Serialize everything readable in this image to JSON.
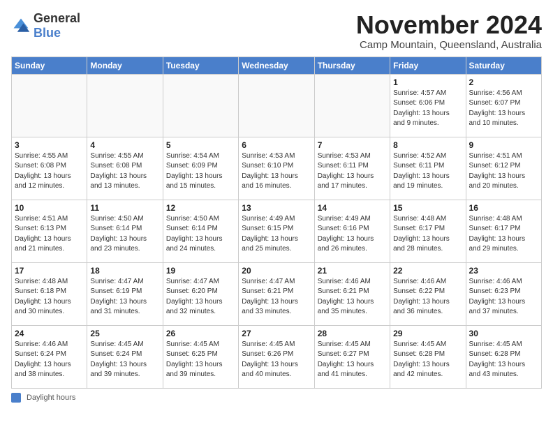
{
  "logo": {
    "general": "General",
    "blue": "Blue"
  },
  "header": {
    "month": "November 2024",
    "location": "Camp Mountain, Queensland, Australia"
  },
  "days_of_week": [
    "Sunday",
    "Monday",
    "Tuesday",
    "Wednesday",
    "Thursday",
    "Friday",
    "Saturday"
  ],
  "weeks": [
    [
      {
        "day": "",
        "info": ""
      },
      {
        "day": "",
        "info": ""
      },
      {
        "day": "",
        "info": ""
      },
      {
        "day": "",
        "info": ""
      },
      {
        "day": "",
        "info": ""
      },
      {
        "day": "1",
        "info": "Sunrise: 4:57 AM\nSunset: 6:06 PM\nDaylight: 13 hours and 9 minutes."
      },
      {
        "day": "2",
        "info": "Sunrise: 4:56 AM\nSunset: 6:07 PM\nDaylight: 13 hours and 10 minutes."
      }
    ],
    [
      {
        "day": "3",
        "info": "Sunrise: 4:55 AM\nSunset: 6:08 PM\nDaylight: 13 hours and 12 minutes."
      },
      {
        "day": "4",
        "info": "Sunrise: 4:55 AM\nSunset: 6:08 PM\nDaylight: 13 hours and 13 minutes."
      },
      {
        "day": "5",
        "info": "Sunrise: 4:54 AM\nSunset: 6:09 PM\nDaylight: 13 hours and 15 minutes."
      },
      {
        "day": "6",
        "info": "Sunrise: 4:53 AM\nSunset: 6:10 PM\nDaylight: 13 hours and 16 minutes."
      },
      {
        "day": "7",
        "info": "Sunrise: 4:53 AM\nSunset: 6:11 PM\nDaylight: 13 hours and 17 minutes."
      },
      {
        "day": "8",
        "info": "Sunrise: 4:52 AM\nSunset: 6:11 PM\nDaylight: 13 hours and 19 minutes."
      },
      {
        "day": "9",
        "info": "Sunrise: 4:51 AM\nSunset: 6:12 PM\nDaylight: 13 hours and 20 minutes."
      }
    ],
    [
      {
        "day": "10",
        "info": "Sunrise: 4:51 AM\nSunset: 6:13 PM\nDaylight: 13 hours and 21 minutes."
      },
      {
        "day": "11",
        "info": "Sunrise: 4:50 AM\nSunset: 6:14 PM\nDaylight: 13 hours and 23 minutes."
      },
      {
        "day": "12",
        "info": "Sunrise: 4:50 AM\nSunset: 6:14 PM\nDaylight: 13 hours and 24 minutes."
      },
      {
        "day": "13",
        "info": "Sunrise: 4:49 AM\nSunset: 6:15 PM\nDaylight: 13 hours and 25 minutes."
      },
      {
        "day": "14",
        "info": "Sunrise: 4:49 AM\nSunset: 6:16 PM\nDaylight: 13 hours and 26 minutes."
      },
      {
        "day": "15",
        "info": "Sunrise: 4:48 AM\nSunset: 6:17 PM\nDaylight: 13 hours and 28 minutes."
      },
      {
        "day": "16",
        "info": "Sunrise: 4:48 AM\nSunset: 6:17 PM\nDaylight: 13 hours and 29 minutes."
      }
    ],
    [
      {
        "day": "17",
        "info": "Sunrise: 4:48 AM\nSunset: 6:18 PM\nDaylight: 13 hours and 30 minutes."
      },
      {
        "day": "18",
        "info": "Sunrise: 4:47 AM\nSunset: 6:19 PM\nDaylight: 13 hours and 31 minutes."
      },
      {
        "day": "19",
        "info": "Sunrise: 4:47 AM\nSunset: 6:20 PM\nDaylight: 13 hours and 32 minutes."
      },
      {
        "day": "20",
        "info": "Sunrise: 4:47 AM\nSunset: 6:21 PM\nDaylight: 13 hours and 33 minutes."
      },
      {
        "day": "21",
        "info": "Sunrise: 4:46 AM\nSunset: 6:21 PM\nDaylight: 13 hours and 35 minutes."
      },
      {
        "day": "22",
        "info": "Sunrise: 4:46 AM\nSunset: 6:22 PM\nDaylight: 13 hours and 36 minutes."
      },
      {
        "day": "23",
        "info": "Sunrise: 4:46 AM\nSunset: 6:23 PM\nDaylight: 13 hours and 37 minutes."
      }
    ],
    [
      {
        "day": "24",
        "info": "Sunrise: 4:46 AM\nSunset: 6:24 PM\nDaylight: 13 hours and 38 minutes."
      },
      {
        "day": "25",
        "info": "Sunrise: 4:45 AM\nSunset: 6:24 PM\nDaylight: 13 hours and 39 minutes."
      },
      {
        "day": "26",
        "info": "Sunrise: 4:45 AM\nSunset: 6:25 PM\nDaylight: 13 hours and 39 minutes."
      },
      {
        "day": "27",
        "info": "Sunrise: 4:45 AM\nSunset: 6:26 PM\nDaylight: 13 hours and 40 minutes."
      },
      {
        "day": "28",
        "info": "Sunrise: 4:45 AM\nSunset: 6:27 PM\nDaylight: 13 hours and 41 minutes."
      },
      {
        "day": "29",
        "info": "Sunrise: 4:45 AM\nSunset: 6:28 PM\nDaylight: 13 hours and 42 minutes."
      },
      {
        "day": "30",
        "info": "Sunrise: 4:45 AM\nSunset: 6:28 PM\nDaylight: 13 hours and 43 minutes."
      }
    ]
  ],
  "footer": {
    "label": "Daylight hours"
  }
}
